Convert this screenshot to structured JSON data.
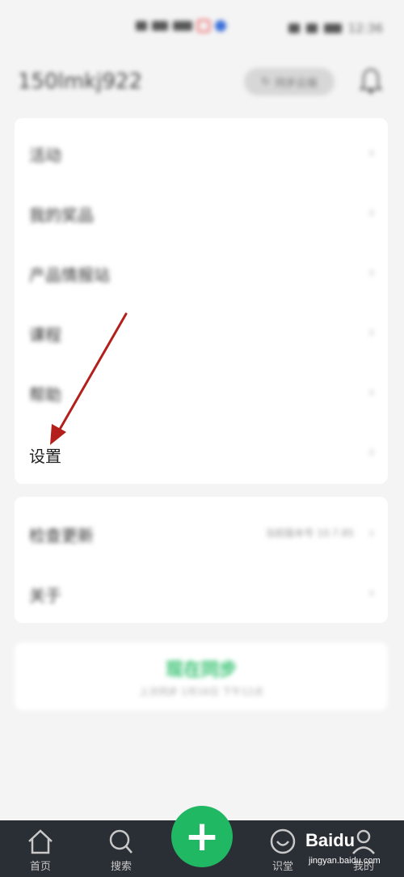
{
  "status_bar": {
    "time": "12:36"
  },
  "header": {
    "username": "150lmkj922",
    "sync_pill_label": "同步云端"
  },
  "menu_card1": {
    "items": [
      {
        "label": "活动"
      },
      {
        "label": "我的奖品"
      },
      {
        "label": "产品情报站"
      },
      {
        "label": "课程"
      },
      {
        "label": "帮助"
      },
      {
        "label": "设置"
      }
    ]
  },
  "menu_card2": {
    "items": [
      {
        "label": "检查更新",
        "sub": "当前版本号 10.7.85"
      },
      {
        "label": "关于"
      }
    ]
  },
  "sync_card": {
    "title": "现在同步",
    "subtitle": "上次同步 1月16日 下午12点"
  },
  "tabbar": {
    "tabs": [
      {
        "label": "首页",
        "icon": "home-icon"
      },
      {
        "label": "搜索",
        "icon": "search-icon"
      },
      {
        "label": "识堂",
        "icon": "smile-circle-icon"
      },
      {
        "label": "我的",
        "icon": "person-icon"
      }
    ],
    "fab_icon": "plus-icon"
  },
  "watermark": {
    "text": "Baidu",
    "url": "jingyan.baidu.com"
  },
  "colors": {
    "accent_green": "#21b863",
    "sync_green": "#2dbf6b",
    "arrow_red": "#b3201b",
    "tabbar_bg": "#2a2e35"
  }
}
